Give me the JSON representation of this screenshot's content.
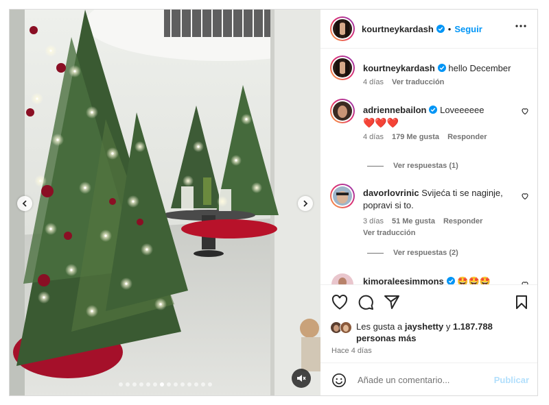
{
  "post": {
    "author": "kourtneykardash",
    "follow_label": "Seguir",
    "caption": "hello December",
    "caption_time": "4 días",
    "see_translation": "Ver traducción"
  },
  "comments": [
    {
      "user": "adriennebailon",
      "verified": true,
      "text": "Loveeeeee",
      "emoji": "❤️❤️❤️",
      "time": "4 días",
      "likes": "179 Me gusta",
      "reply": "Responder",
      "view_replies": "Ver respuestas (1)"
    },
    {
      "user": "davorlovrinic",
      "verified": false,
      "text": "Svijeća ti se naginje, popravi si to.",
      "time": "3 días",
      "likes": "51 Me gusta",
      "reply": "Responder",
      "translation": "Ver traducción",
      "view_replies": "Ver respuestas (2)"
    },
    {
      "user": "kimoraleesimmons",
      "verified": true,
      "text": "🤩🤩🤩"
    }
  ],
  "likes_summary": {
    "prefix": "Les gusta a",
    "user": "jayshetty",
    "joiner": "y",
    "count": "1.187.788 personas más"
  },
  "posted_ago": "Hace 4 días",
  "add_comment": {
    "placeholder": "Añade un comentario...",
    "publish": "Publicar"
  },
  "carousel": {
    "total": 14,
    "active": 6
  },
  "colors": {
    "accent": "#0095f6",
    "verified": "#0095f6",
    "muted": "#737373"
  }
}
